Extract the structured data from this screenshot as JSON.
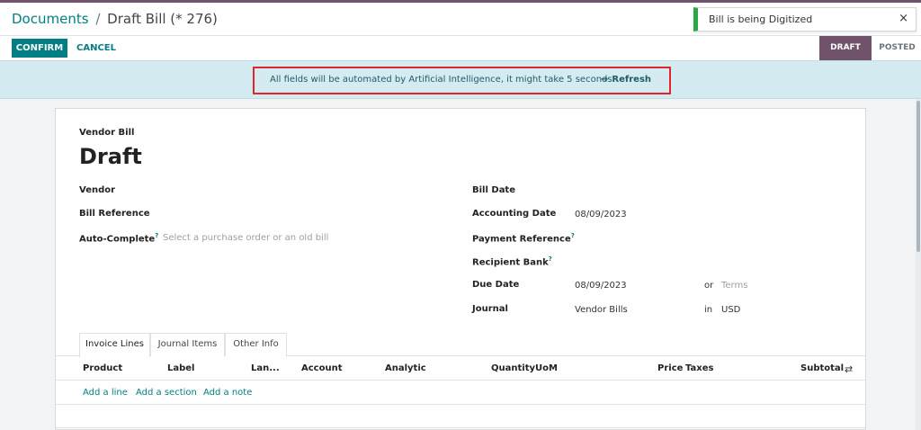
{
  "breadcrumb": {
    "parent": "Documents",
    "separator": "/",
    "current": "Draft Bill (* 276)"
  },
  "toast": {
    "message": "Bill is being Digitized",
    "close": "×"
  },
  "control_panel": {
    "confirm_label": "CONFIRM",
    "cancel_label": "CANCEL"
  },
  "statusbar": {
    "draft": "DRAFT",
    "posted": "POSTED"
  },
  "ai_banner": {
    "message": "All fields will be automated by Artificial Intelligence, it might take 5 seconds.",
    "refresh_label": "Refresh",
    "refresh_icon": "➔"
  },
  "form": {
    "doc_type": "Vendor Bill",
    "doc_name": "Draft",
    "left": {
      "vendor_label": "Vendor",
      "bill_ref_label": "Bill Reference",
      "autocomplete_label": "Auto-Complete",
      "autocomplete_help": "?",
      "autocomplete_placeholder": "Select a purchase order or an old bill"
    },
    "right": {
      "bill_date_label": "Bill Date",
      "accounting_date_label": "Accounting Date",
      "accounting_date_value": "08/09/2023",
      "payment_ref_label": "Payment Reference",
      "payment_ref_help": "?",
      "recipient_bank_label": "Recipient Bank",
      "recipient_bank_help": "?",
      "due_date_label": "Due Date",
      "due_date_value": "08/09/2023",
      "due_or": "or",
      "terms_placeholder": "Terms",
      "journal_label": "Journal",
      "journal_value": "Vendor Bills",
      "journal_in": "in",
      "currency_value": "USD"
    }
  },
  "tabs": [
    "Invoice Lines",
    "Journal Items",
    "Other Info"
  ],
  "table": {
    "columns": [
      "Product",
      "Label",
      "Lan...",
      "Account",
      "Analytic",
      "Quantity",
      "UoM",
      "Price",
      "Taxes",
      "Subtotal"
    ],
    "settings_icon": "⇄",
    "add_line": "Add a line",
    "add_section": "Add a section",
    "add_note": "Add a note"
  },
  "colors": {
    "primary": "#017e84",
    "status_active": "#71526b",
    "banner_bg": "#d4ecf1",
    "highlight": "#e0262b",
    "toast_success": "#28a745"
  }
}
